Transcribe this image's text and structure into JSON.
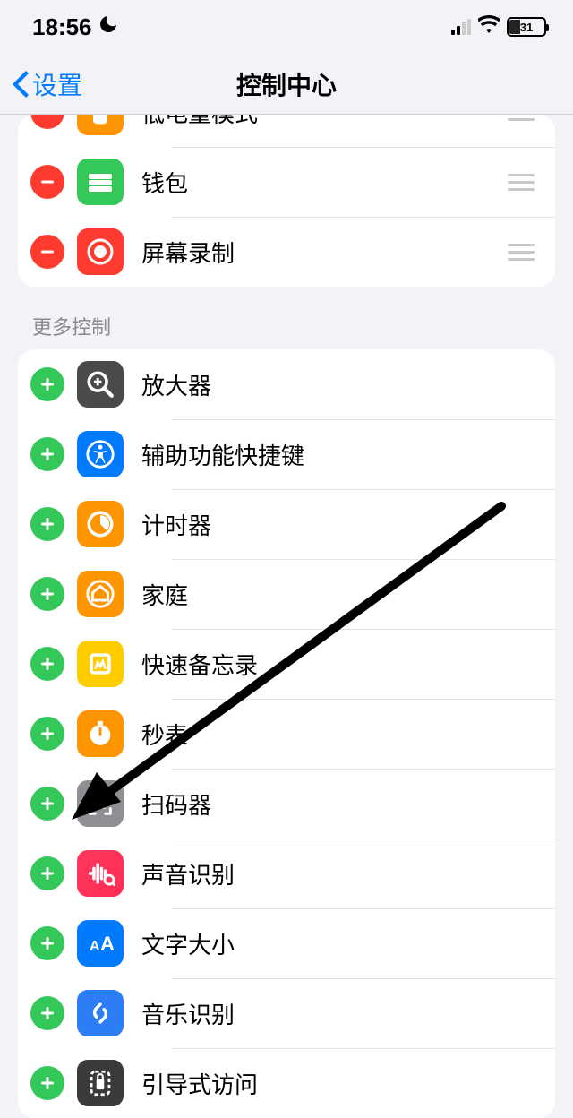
{
  "status": {
    "time": "18:56",
    "battery_pct": "31"
  },
  "nav": {
    "back_label": "设置",
    "title": "控制中心"
  },
  "included_partial_label": "低电量模式",
  "included": [
    {
      "label": "钱包",
      "icon": "wallet"
    },
    {
      "label": "屏幕录制",
      "icon": "record"
    }
  ],
  "more_header": "更多控制",
  "more": [
    {
      "label": "放大器",
      "icon": "magnifier"
    },
    {
      "label": "辅助功能快捷键",
      "icon": "access"
    },
    {
      "label": "计时器",
      "icon": "timer"
    },
    {
      "label": "家庭",
      "icon": "home"
    },
    {
      "label": "快速备忘录",
      "icon": "note"
    },
    {
      "label": "秒表",
      "icon": "stopwatch"
    },
    {
      "label": "扫码器",
      "icon": "qr"
    },
    {
      "label": "声音识别",
      "icon": "sound"
    },
    {
      "label": "文字大小",
      "icon": "textsize"
    },
    {
      "label": "音乐识别",
      "icon": "shazam"
    },
    {
      "label": "引导式访问",
      "icon": "guided"
    }
  ]
}
